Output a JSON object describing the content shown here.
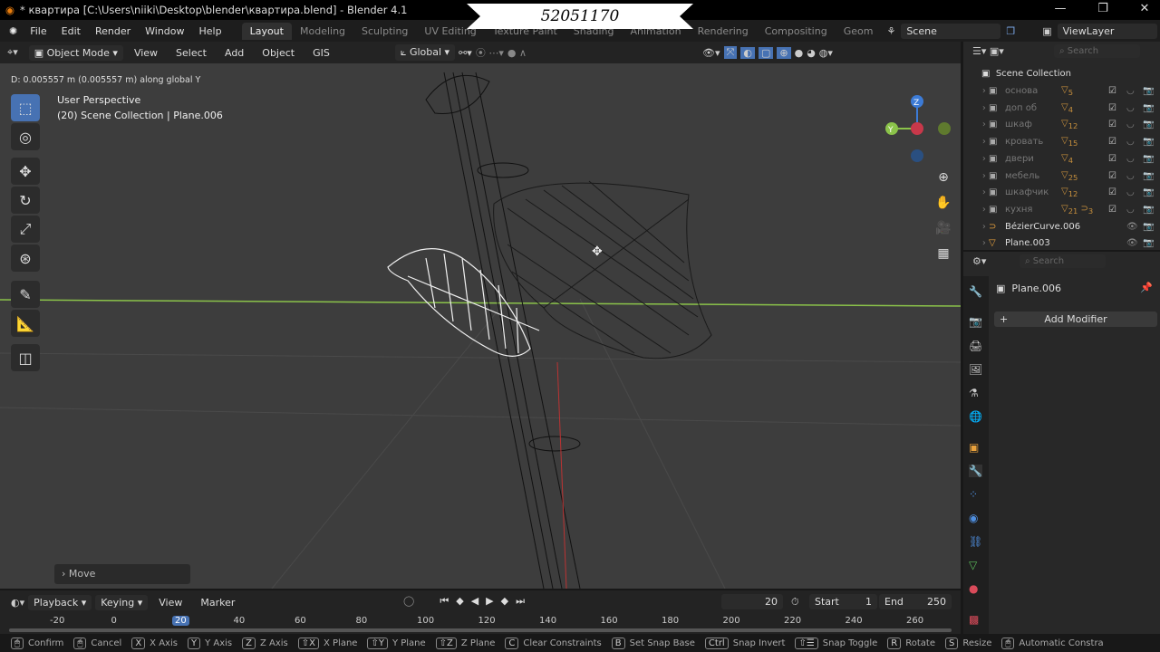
{
  "titlebar": {
    "title": "* квартира [C:\\Users\\niiki\\Desktop\\blender\\квартира.blend] - Blender 4.1",
    "minimize": "—",
    "maximize": "❐",
    "close": "✕"
  },
  "overlay_badge": "52051170",
  "menu": {
    "items": [
      "File",
      "Edit",
      "Render",
      "Window",
      "Help"
    ]
  },
  "workspaces": [
    {
      "label": "Layout",
      "active": true
    },
    {
      "label": "Modeling"
    },
    {
      "label": "Sculpting"
    },
    {
      "label": "UV Editing"
    },
    {
      "label": "Texture Paint"
    },
    {
      "label": "Shading"
    },
    {
      "label": "Animation"
    },
    {
      "label": "Rendering"
    },
    {
      "label": "Compositing"
    },
    {
      "label": "Geom"
    }
  ],
  "scene": {
    "name": "Scene",
    "view_layer": "ViewLayer"
  },
  "viewport_header": {
    "mode": "Object Mode",
    "menus": [
      "View",
      "Select",
      "Add",
      "Object",
      "GIS"
    ],
    "orientation": "Global"
  },
  "operator_info": "D: 0.005557 m (0.005557 m) along global Y",
  "viewport": {
    "perspective": "User Perspective",
    "collection": "(20) Scene Collection | Plane.006",
    "last_op": "Move",
    "axis_labels": {
      "x": "X",
      "y": "Y",
      "z": "Z"
    }
  },
  "outliner": {
    "search_placeholder": "Search",
    "root": "Scene Collection",
    "items": [
      {
        "name": "основа",
        "count": "5",
        "type": "collection"
      },
      {
        "name": "доп об",
        "count": "4",
        "type": "collection"
      },
      {
        "name": "шкаф",
        "count": "12",
        "type": "collection"
      },
      {
        "name": "кровать",
        "count": "15",
        "type": "collection"
      },
      {
        "name": "двери",
        "count": "4",
        "type": "collection"
      },
      {
        "name": "мебель",
        "count": "25",
        "type": "collection"
      },
      {
        "name": "шкафчик",
        "count": "12",
        "type": "collection"
      },
      {
        "name": "кухня",
        "count": "21",
        "count2": "3",
        "type": "collection"
      },
      {
        "name": "BézierCurve.006",
        "count": "",
        "type": "curve"
      },
      {
        "name": "Plane.003",
        "count": "",
        "type": "mesh"
      }
    ]
  },
  "properties": {
    "search_placeholder": "Search",
    "object": "Plane.006",
    "add_modifier": "Add Modifier"
  },
  "timeline": {
    "menus": [
      "Playback",
      "Keying",
      "View",
      "Marker"
    ],
    "current_frame": "20",
    "start_label": "Start",
    "start": "1",
    "end_label": "End",
    "end": "250",
    "ruler": [
      "-20",
      "0",
      "20",
      "40",
      "60",
      "80",
      "100",
      "120",
      "140",
      "160",
      "180",
      "200",
      "220",
      "240",
      "260"
    ]
  },
  "status": [
    {
      "key": "🖱",
      "label": "Confirm"
    },
    {
      "key": "🖱",
      "label": "Cancel"
    },
    {
      "key": "X",
      "label": "X Axis"
    },
    {
      "key": "Y",
      "label": "Y Axis"
    },
    {
      "key": "Z",
      "label": "Z Axis"
    },
    {
      "key": "⇧X",
      "label": "X Plane"
    },
    {
      "key": "⇧Y",
      "label": "Y Plane"
    },
    {
      "key": "⇧Z",
      "label": "Z Plane"
    },
    {
      "key": "C",
      "label": "Clear Constraints"
    },
    {
      "key": "B",
      "label": "Set Snap Base"
    },
    {
      "key": "Ctrl",
      "label": "Snap Invert"
    },
    {
      "key": "⇧☰",
      "label": "Snap Toggle"
    },
    {
      "key": "R",
      "label": "Rotate"
    },
    {
      "key": "S",
      "label": "Resize"
    },
    {
      "key": "🖱",
      "label": "Automatic Constra"
    }
  ],
  "colors": {
    "accent": "#4772b3",
    "frame_marker": "#4772b3",
    "x_axis": "#c8384a",
    "y_axis": "#8bc34a",
    "z_axis": "#3c7bd6",
    "collection_icon": "#c9913d"
  }
}
